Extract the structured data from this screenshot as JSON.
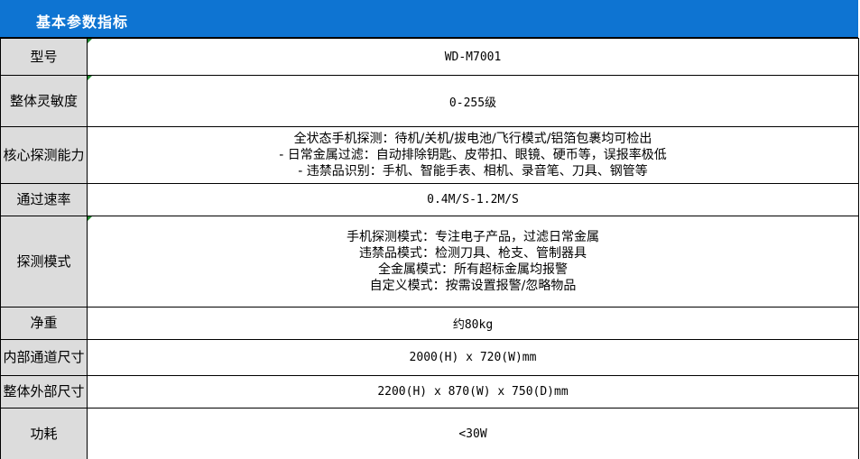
{
  "header": {
    "title": "基本参数指标"
  },
  "rows": [
    {
      "label": "型号",
      "lines": [
        "WD-M7001"
      ]
    },
    {
      "label": "整体灵敏度",
      "lines": [
        "0-255级"
      ]
    },
    {
      "label": "核心探测能力",
      "lines": [
        "全状态手机探测：待机/关机/拔电池/飞行模式/铝箔包裹均可检出",
        "- 日常金属过滤：自动排除钥匙、皮带扣、眼镜、硬币等，误报率极低",
        "- 违禁品识别：手机、智能手表、相机、录音笔、刀具、钢管等"
      ]
    },
    {
      "label": "通过速率",
      "lines": [
        "0.4M/S-1.2M/S"
      ]
    },
    {
      "label": "探测模式",
      "lines": [
        "手机探测模式：专注电子产品，过滤日常金属",
        "违禁品模式：检测刀具、枪支、管制器具",
        "全金属模式：所有超标金属均报警",
        "自定义模式：按需设置报警/忽略物品"
      ]
    },
    {
      "label": "净重",
      "lines": [
        "约80kg"
      ]
    },
    {
      "label": "内部通道尺寸",
      "lines": [
        "2000(H) x 720(W)mm"
      ]
    },
    {
      "label": "整体外部尺寸",
      "lines": [
        "2200(H) x 870(W) x 750(D)mm"
      ]
    },
    {
      "label": "功耗",
      "lines": [
        "<30W"
      ]
    }
  ]
}
